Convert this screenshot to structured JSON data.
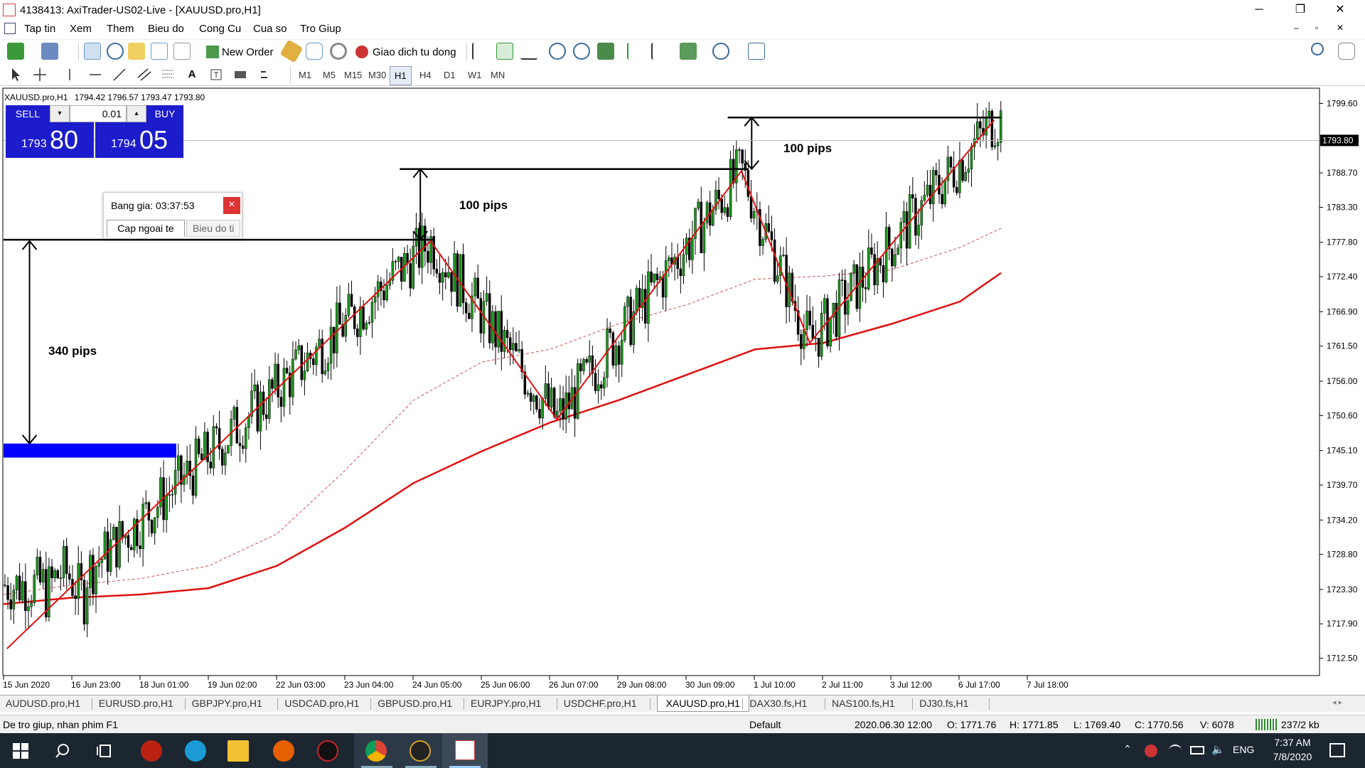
{
  "window": {
    "title": "4138413: AxiTrader-US02-Live - [XAUUSD.pro,H1]",
    "minimize": "─",
    "restore": "❐",
    "close": "✕",
    "child_min": "–",
    "child_restore": "▫",
    "child_close": "✕"
  },
  "menu": [
    "Tap tin",
    "Xem",
    "Them",
    "Bieu do",
    "Cong Cu",
    "Cua so",
    "Tro Giup"
  ],
  "toolbar": {
    "new_order": "New Order",
    "auto_trading": "Giao dich tu dong",
    "timeframes": [
      "M1",
      "M5",
      "M15",
      "M30",
      "H1",
      "H4",
      "D1",
      "W1",
      "MN"
    ],
    "active_timeframe": "H1"
  },
  "chart_header": {
    "symbol_line": "XAUUSD.pro,H1",
    "ohlc": "1794.42 1796.57 1793.47 1793.80"
  },
  "one_click": {
    "sell_label": "SELL",
    "buy_label": "BUY",
    "lot": "0.01",
    "sell_price_small": "1793",
    "sell_price_big": "80",
    "buy_price_small": "1794",
    "buy_price_big": "05"
  },
  "market_watch": {
    "title": "Bang gia: 03:37:53",
    "close": "×",
    "tab1": "Cap ngoai te",
    "tab2": "Bieu do ti"
  },
  "annotations": {
    "pips_340": "340 pips",
    "pips_100_a": "100 pips",
    "pips_100_b": "100 pips"
  },
  "chart_data": {
    "type": "candlestick",
    "symbol": "XAUUSD.pro",
    "timeframe": "H1",
    "current_price": "1793.80",
    "ylim": [
      1710,
      1802
    ],
    "price_ticks": [
      "1799.60",
      "1788.70",
      "1783.30",
      "1777.80",
      "1772.40",
      "1766.90",
      "1761.50",
      "1756.00",
      "1750.60",
      "1745.10",
      "1739.70",
      "1734.20",
      "1728.80",
      "1723.30",
      "1717.90",
      "1712.50"
    ],
    "time_ticks": [
      "15 Jun 2020",
      "16 Jun 23:00",
      "18 Jun 01:00",
      "19 Jun 02:00",
      "22 Jun 03:00",
      "23 Jun 04:00",
      "24 Jun 05:00",
      "25 Jun 06:00",
      "26 Jun 07:00",
      "29 Jun 08:00",
      "30 Jun 09:00",
      "1 Jul 10:00",
      "2 Jul 11:00",
      "3 Jul 12:00",
      "6 Jul 17:00",
      "7 Jul 18:00"
    ],
    "zigzag": [
      [
        0.05,
        1714
      ],
      [
        6.25,
        1778
      ],
      [
        8.1,
        1750
      ],
      [
        10.8,
        1789
      ],
      [
        11.8,
        1762
      ],
      [
        14.5,
        1797
      ]
    ],
    "support_zone": {
      "from": 1744.0,
      "to": 1746.2
    },
    "levels": [
      {
        "price": 1778.2,
        "from": 0.0,
        "to": 6.3
      },
      {
        "price": 1789.3,
        "from": 5.8,
        "to": 10.9
      },
      {
        "price": 1797.4,
        "from": 10.6,
        "to": 14.6
      }
    ],
    "ma_slow": [
      [
        0,
        1721
      ],
      [
        1,
        1722
      ],
      [
        2,
        1722.5
      ],
      [
        3,
        1723.5
      ],
      [
        4,
        1727
      ],
      [
        5,
        1733
      ],
      [
        6,
        1740
      ],
      [
        7,
        1745
      ],
      [
        8,
        1749.5
      ],
      [
        9,
        1753
      ],
      [
        10,
        1757
      ],
      [
        11,
        1761
      ],
      [
        12,
        1762
      ],
      [
        13,
        1765
      ],
      [
        14,
        1768.5
      ],
      [
        14.6,
        1773
      ]
    ],
    "ma_fast": [
      [
        0,
        1722.5
      ],
      [
        1,
        1724
      ],
      [
        2,
        1725
      ],
      [
        3,
        1727
      ],
      [
        4,
        1732
      ],
      [
        5,
        1742
      ],
      [
        6,
        1753
      ],
      [
        7,
        1759
      ],
      [
        8,
        1761
      ],
      [
        9,
        1765
      ],
      [
        10,
        1768
      ],
      [
        11,
        1772
      ],
      [
        12,
        1772.5
      ],
      [
        13,
        1773.5
      ],
      [
        14,
        1777
      ],
      [
        14.6,
        1780
      ]
    ]
  },
  "tabs": [
    "AUDUSD.pro,H1",
    "EURUSD.pro,H1",
    "GBPJPY.pro,H1",
    "USDCAD.pro,H1",
    "GBPUSD.pro,H1",
    "EURJPY.pro,H1",
    "USDCHF.pro,H1",
    "XAUUSD.pro,H1",
    "DAX30.fs,H1",
    "NAS100.fs,H1",
    "DJ30.fs,H1"
  ],
  "active_tab": "XAUUSD.pro,H1",
  "status": {
    "help": "De tro giup, nhan phim F1",
    "profile": "Default",
    "datetime": "2020.06.30 12:00",
    "open": "O: 1771.76",
    "high": "H: 1771.85",
    "low": "L: 1769.40",
    "close": "C: 1770.56",
    "volume": "V: 6078",
    "traffic": "237/2 kb"
  },
  "taskbar": {
    "lang": "ENG",
    "time": "7:37 AM",
    "date": "7/8/2020"
  }
}
